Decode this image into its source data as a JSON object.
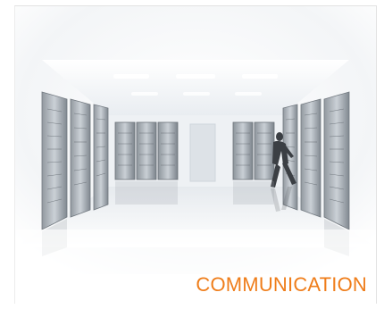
{
  "image": {
    "alt_semantic": "server-room-photo-icon"
  },
  "caption": {
    "text": "COMMUNICATION",
    "color": "#ef7d1a"
  }
}
